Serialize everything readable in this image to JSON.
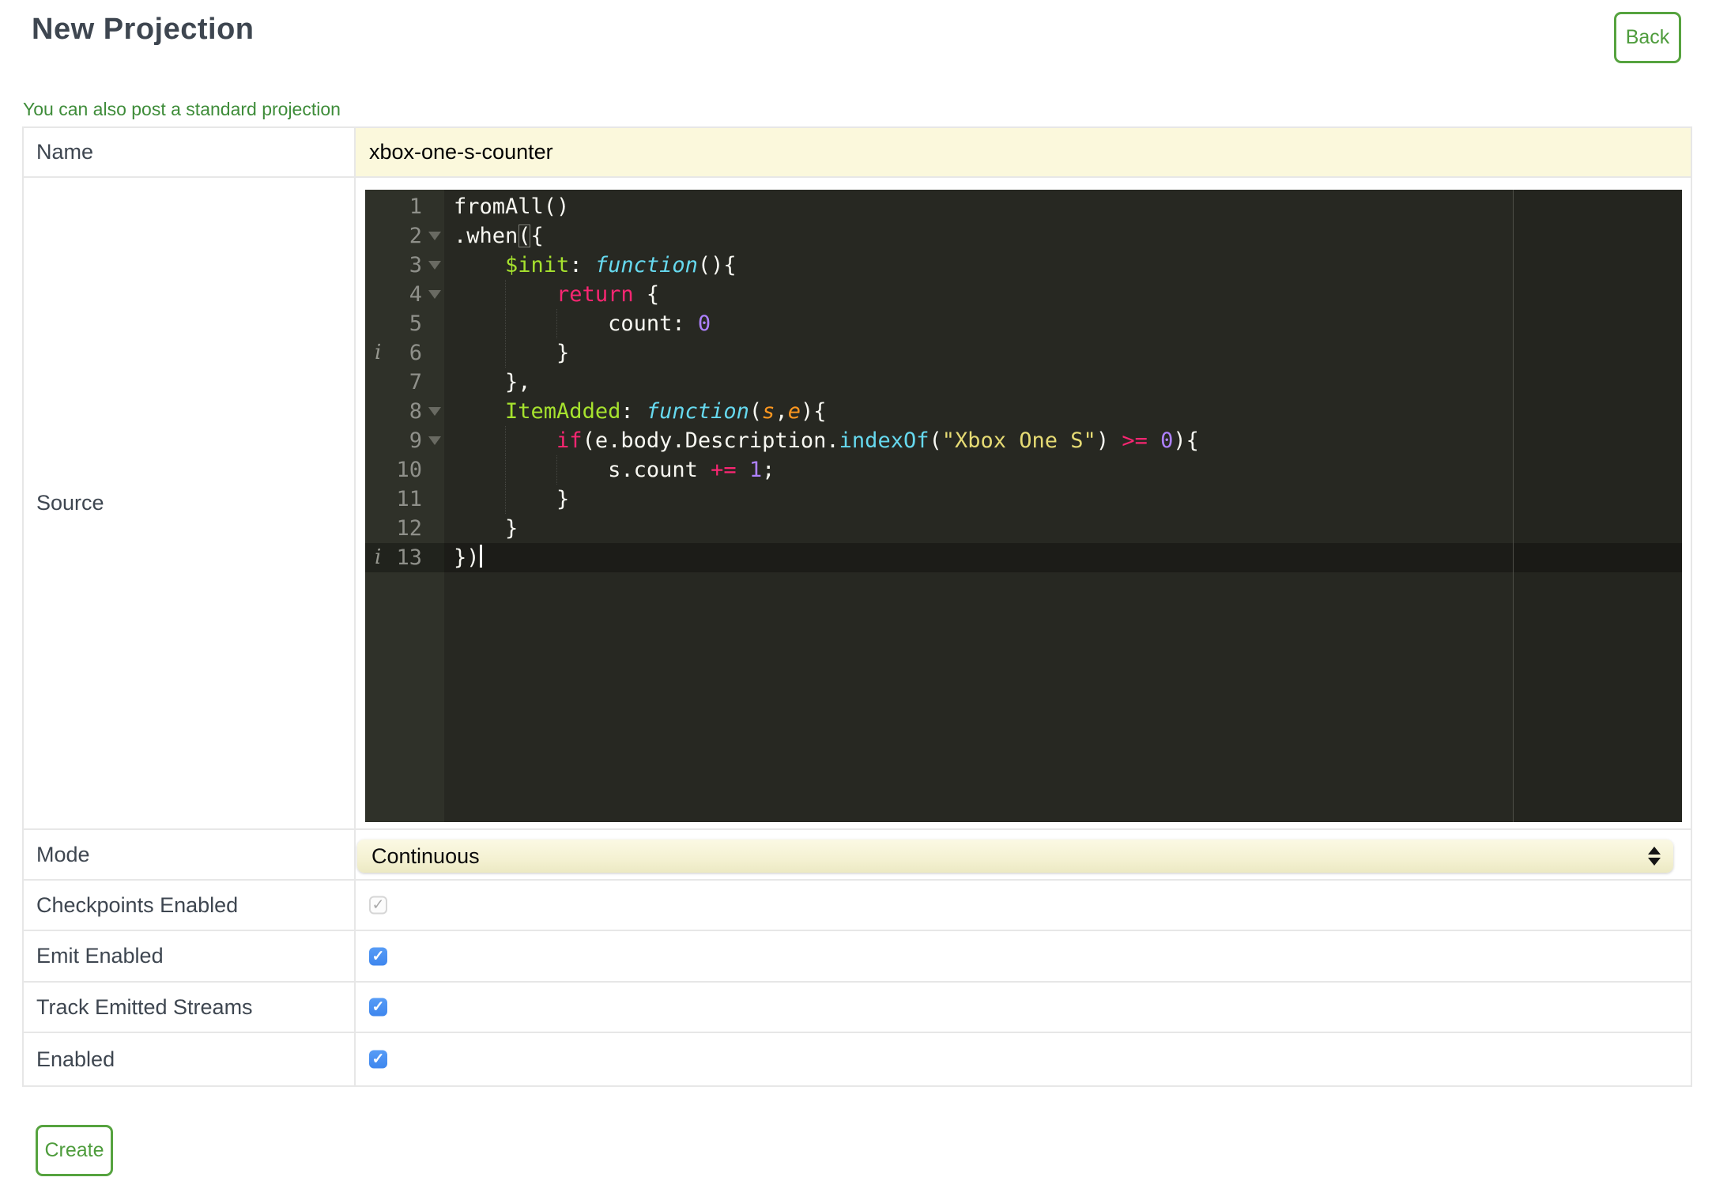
{
  "header": {
    "title": "New Projection",
    "back_label": "Back"
  },
  "link_text": "You can also post a standard projection",
  "create_label": "Create",
  "form": {
    "rows": [
      {
        "label": "Name"
      },
      {
        "label": "Source"
      },
      {
        "label": "Mode"
      },
      {
        "label": "Checkpoints Enabled"
      },
      {
        "label": "Emit Enabled"
      },
      {
        "label": "Track Emitted Streams"
      },
      {
        "label": "Enabled"
      }
    ],
    "name_value": "xbox-one-s-counter",
    "mode_value": "Continuous",
    "checkpoints_enabled": {
      "checked": true,
      "disabled": true
    },
    "emit_enabled": {
      "checked": true,
      "disabled": false
    },
    "track_emitted_streams": {
      "checked": true,
      "disabled": false
    },
    "enabled": {
      "checked": true,
      "disabled": false
    }
  },
  "editor": {
    "language": "javascript",
    "active_line": 13,
    "colors": {
      "background": "#272822",
      "gutter": "#2F3129",
      "text": "#F8F8F2",
      "keyword": "#F92672",
      "entity_name": "#A6E22E",
      "storage": "#66D9EF",
      "parameter": "#FD971F",
      "support_function": "#66D9EF",
      "string": "#E6DB74",
      "number": "#AE81FF",
      "line_number": "#8F908A"
    },
    "lines": [
      {
        "n": 1,
        "fold": false,
        "info": false,
        "guides": [],
        "tokens": [
          [
            "fromAll()",
            "pl"
          ]
        ]
      },
      {
        "n": 2,
        "fold": true,
        "info": false,
        "guides": [],
        "tokens": [
          [
            ".when",
            "pl"
          ],
          [
            "(",
            "brk"
          ],
          [
            "{",
            "pl"
          ]
        ]
      },
      {
        "n": 3,
        "fold": true,
        "info": false,
        "guides": [],
        "tokens": [
          [
            "    ",
            "pl"
          ],
          [
            "$init",
            "fn"
          ],
          [
            ": ",
            "pl"
          ],
          [
            "function",
            "st"
          ],
          [
            "(){",
            "pl"
          ]
        ]
      },
      {
        "n": 4,
        "fold": true,
        "info": false,
        "guides": [
          4
        ],
        "tokens": [
          [
            "        ",
            "pl"
          ],
          [
            "return",
            "kw"
          ],
          [
            " {",
            "pl"
          ]
        ]
      },
      {
        "n": 5,
        "fold": false,
        "info": false,
        "guides": [
          4,
          8
        ],
        "tokens": [
          [
            "            count: ",
            "pl"
          ],
          [
            "0",
            "nu"
          ]
        ]
      },
      {
        "n": 6,
        "fold": false,
        "info": true,
        "guides": [
          4
        ],
        "tokens": [
          [
            "        }",
            "pl"
          ]
        ]
      },
      {
        "n": 7,
        "fold": false,
        "info": false,
        "guides": [],
        "tokens": [
          [
            "    },",
            "pl"
          ]
        ]
      },
      {
        "n": 8,
        "fold": true,
        "info": false,
        "guides": [],
        "tokens": [
          [
            "    ",
            "pl"
          ],
          [
            "ItemAdded",
            "fn"
          ],
          [
            ": ",
            "pl"
          ],
          [
            "function",
            "st"
          ],
          [
            "(",
            "pl"
          ],
          [
            "s",
            "pa"
          ],
          [
            ",",
            "pl"
          ],
          [
            "e",
            "pa"
          ],
          [
            "){",
            "pl"
          ]
        ]
      },
      {
        "n": 9,
        "fold": true,
        "info": false,
        "guides": [
          4
        ],
        "tokens": [
          [
            "        ",
            "pl"
          ],
          [
            "if",
            "kw"
          ],
          [
            "(e.body.Description.",
            "pl"
          ],
          [
            "indexOf",
            "su"
          ],
          [
            "(",
            "pl"
          ],
          [
            "\"Xbox One S\"",
            "str"
          ],
          [
            ") ",
            "pl"
          ],
          [
            ">=",
            "kw"
          ],
          [
            " ",
            "pl"
          ],
          [
            "0",
            "nu"
          ],
          [
            "){",
            "pl"
          ]
        ]
      },
      {
        "n": 10,
        "fold": false,
        "info": false,
        "guides": [
          4,
          8
        ],
        "tokens": [
          [
            "            s.count ",
            "pl"
          ],
          [
            "+=",
            "kw"
          ],
          [
            " ",
            "pl"
          ],
          [
            "1",
            "nu"
          ],
          [
            ";",
            "pl"
          ]
        ]
      },
      {
        "n": 11,
        "fold": false,
        "info": false,
        "guides": [
          4
        ],
        "tokens": [
          [
            "        }",
            "pl"
          ]
        ]
      },
      {
        "n": 12,
        "fold": false,
        "info": false,
        "guides": [],
        "tokens": [
          [
            "    }",
            "pl"
          ]
        ]
      },
      {
        "n": 13,
        "fold": false,
        "info": true,
        "guides": [],
        "tokens": [
          [
            "})",
            "pl"
          ]
        ]
      }
    ]
  },
  "colors": {
    "accent_green": "#56A33F",
    "link_green": "#3E8C39",
    "heading_text": "#3E4650",
    "field_yellow": "#FBF8DC",
    "checkbox_blue": "#4791F0",
    "table_border": "#E7E7E7"
  }
}
